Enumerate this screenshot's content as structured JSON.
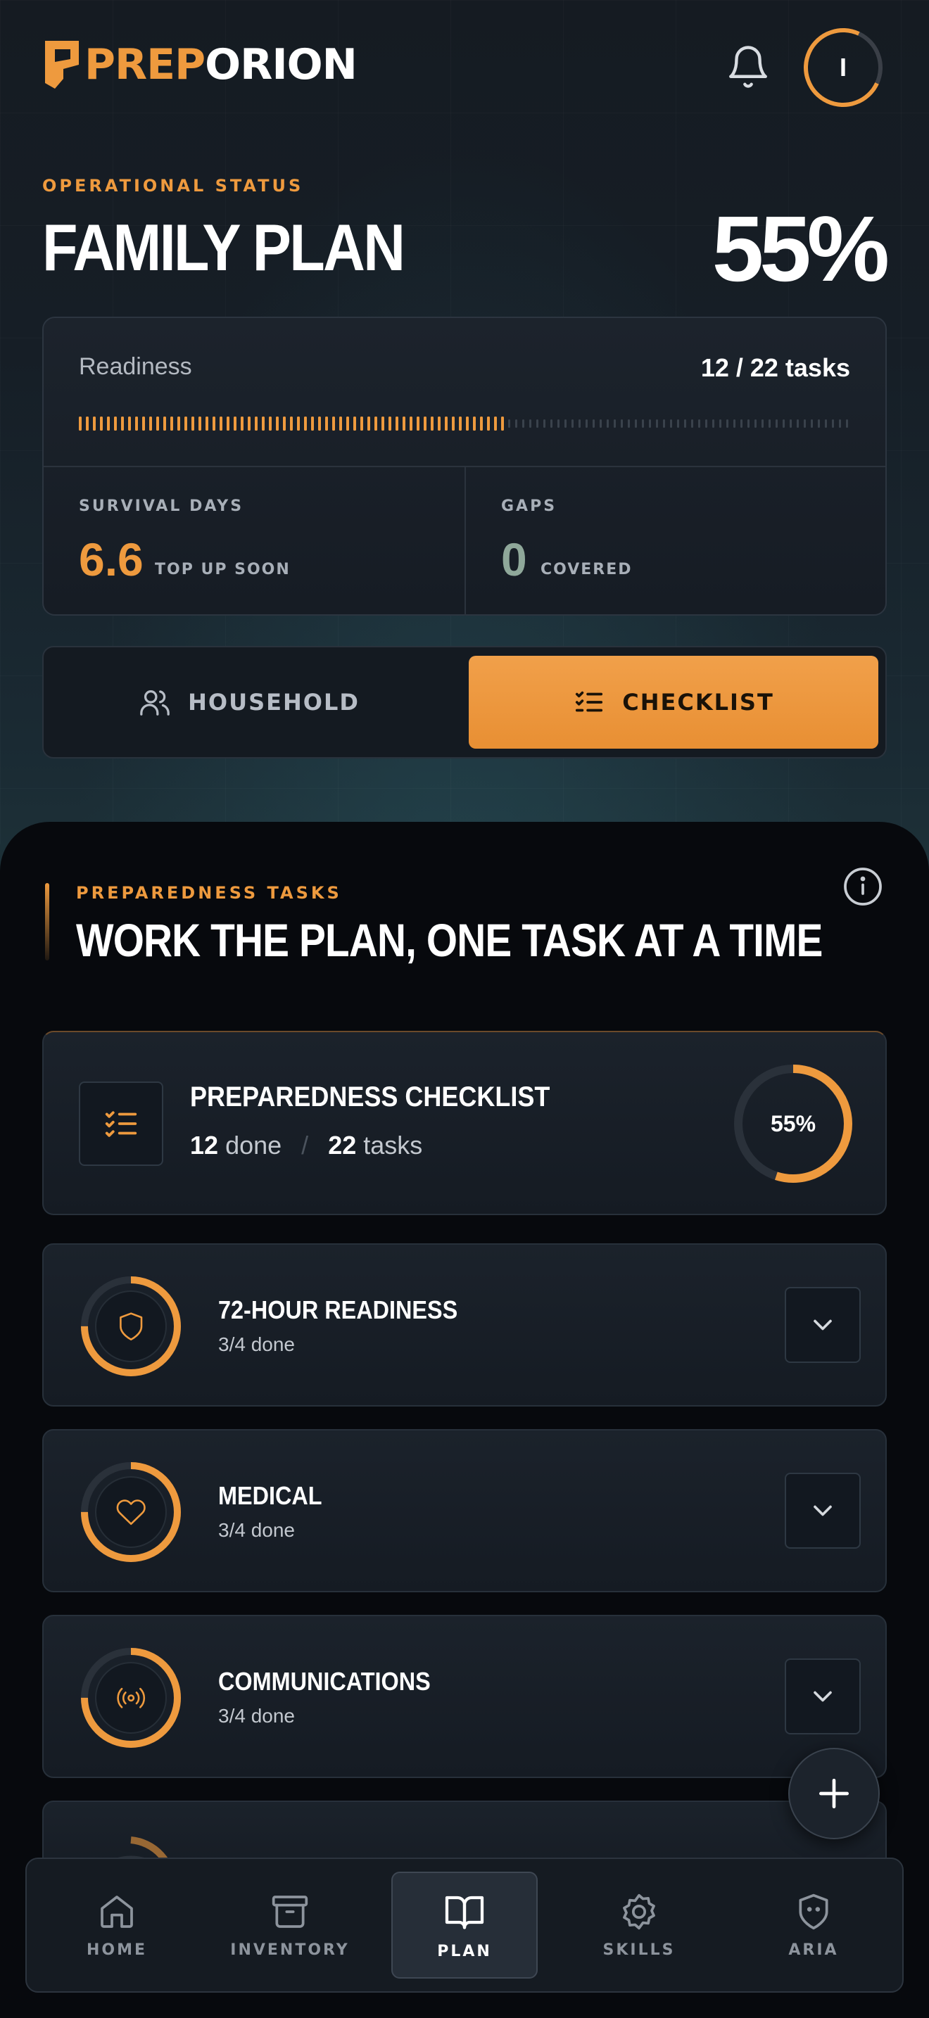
{
  "brand": {
    "prefix": "PREP",
    "suffix": "ORION"
  },
  "header": {
    "avatar_initial": "I"
  },
  "status": {
    "eyebrow": "OPERATIONAL STATUS",
    "title": "FAMILY PLAN",
    "percent": "55%"
  },
  "readiness": {
    "label": "Readiness",
    "count": "12 / 22 tasks",
    "fraction": 0.55,
    "survival_label": "SURVIVAL DAYS",
    "survival_value": "6.6",
    "survival_sub": "TOP UP SOON",
    "gaps_label": "GAPS",
    "gaps_value": "0",
    "gaps_sub": "COVERED"
  },
  "toggle": {
    "household": "HOUSEHOLD",
    "checklist": "CHECKLIST",
    "active": "checklist"
  },
  "section": {
    "eyebrow": "PREPAREDNESS TASKS",
    "title": "WORK THE PLAN, ONE TASK AT A TIME"
  },
  "checklist": {
    "title": "PREPAREDNESS CHECKLIST",
    "done": "12",
    "done_label": "done",
    "sep": "/",
    "total": "22",
    "total_label": "tasks",
    "percent": "55%",
    "fraction": 0.55
  },
  "categories": [
    {
      "title": "72-HOUR READINESS",
      "sub": "3/4 done",
      "icon": "shield-icon",
      "fraction": 0.75
    },
    {
      "title": "MEDICAL",
      "sub": "3/4 done",
      "icon": "heart-icon",
      "fraction": 0.75
    },
    {
      "title": "COMMUNICATIONS",
      "sub": "3/4 done",
      "icon": "broadcast-icon",
      "fraction": 0.75
    }
  ],
  "nav": [
    {
      "label": "HOME",
      "icon": "home-icon"
    },
    {
      "label": "INVENTORY",
      "icon": "archive-icon"
    },
    {
      "label": "PLAN",
      "icon": "book-icon",
      "active": true
    },
    {
      "label": "SKILLS",
      "icon": "badge-icon"
    },
    {
      "label": "ARIA",
      "icon": "shield-face-icon"
    }
  ],
  "colors": {
    "accent": "#ee9a3e",
    "ring_track": "#2a313a",
    "gaps": "#8fa89a"
  }
}
